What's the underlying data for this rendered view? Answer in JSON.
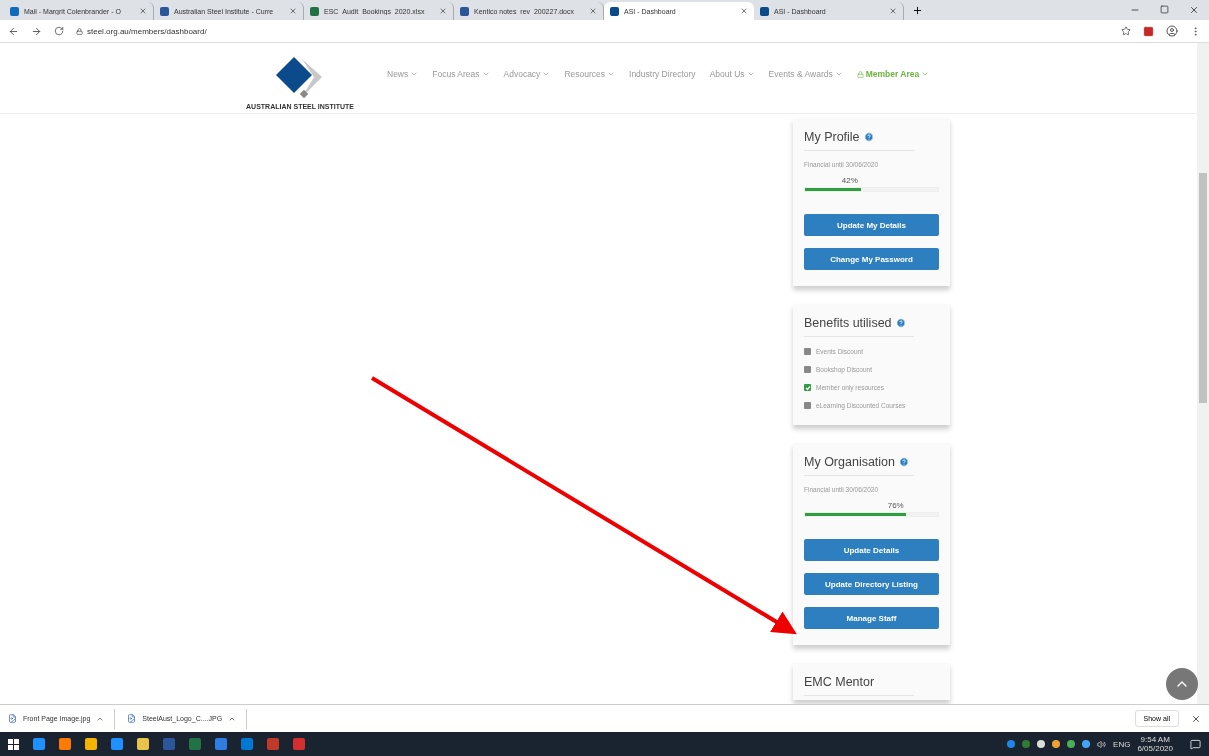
{
  "browser": {
    "tabs": [
      {
        "label": "Mail - Margrit Colenbrander - O",
        "selected": false,
        "color": "#0f6cbd"
      },
      {
        "label": "Australian Steel Institute - Curre",
        "selected": false,
        "color": "#2b579a"
      },
      {
        "label": "ESC_Audit_Bookings_2020.xlsx",
        "selected": false,
        "color": "#217346"
      },
      {
        "label": "Kentico notes_rev_200227.docx",
        "selected": false,
        "color": "#2b579a"
      },
      {
        "label": "ASI - Dashboard",
        "selected": true,
        "color": "#0b4a8b"
      },
      {
        "label": "ASI - Dashboard",
        "selected": false,
        "color": "#0b4a8b"
      }
    ],
    "url": "steel.org.au/members/dashboard/"
  },
  "site": {
    "logo_text": "AUSTRALIAN STEEL INSTITUTE",
    "nav": [
      {
        "label": "News",
        "dropdown": true,
        "kind": "plain"
      },
      {
        "label": "Focus Areas",
        "dropdown": true,
        "kind": "plain"
      },
      {
        "label": "Advocacy",
        "dropdown": true,
        "kind": "plain"
      },
      {
        "label": "Resources",
        "dropdown": true,
        "kind": "plain"
      },
      {
        "label": "Industry Directory",
        "dropdown": false,
        "kind": "plain"
      },
      {
        "label": "About Us",
        "dropdown": true,
        "kind": "plain"
      },
      {
        "label": "Events & Awards",
        "dropdown": true,
        "kind": "plain"
      },
      {
        "label": "Member Area",
        "dropdown": true,
        "kind": "member"
      }
    ]
  },
  "cards": [
    {
      "title": "My Profile",
      "kind": "progress",
      "subtitle": "Financial until 30/06/2020",
      "level": 0.42,
      "reading": "42%",
      "buttons": [
        "Update My Details",
        "Change My Password"
      ]
    },
    {
      "title": "Benefits utilised",
      "kind": "checklist",
      "items": [
        {
          "label": "Events Discount",
          "checked": false
        },
        {
          "label": "Bookshop Discount",
          "checked": false
        },
        {
          "label": "Member only resources",
          "checked": true
        },
        {
          "label": "eLearning Discounted Courses",
          "checked": false
        }
      ]
    },
    {
      "title": "My Organisation",
      "kind": "progress",
      "subtitle": "Financial until 30/06/2020",
      "level": 0.76,
      "reading": "76%",
      "buttons": [
        "Update Details",
        "Update Directory Listing",
        "Manage Staff"
      ]
    },
    {
      "title": "EMC Mentor",
      "kind": "partial"
    }
  ],
  "downloads": {
    "files": [
      "Front Page Image.jpg",
      "SteelAust_Logo_C....JPG"
    ],
    "show_all": "Show all"
  },
  "taskbar": {
    "apps": [
      {
        "color": "#1e90ff"
      },
      {
        "color": "#ff7a00"
      },
      {
        "color": "#f4b400"
      },
      {
        "color": "#1e90ff"
      },
      {
        "color": "#e8c34a"
      },
      {
        "color": "#2b579a"
      },
      {
        "color": "#217346"
      },
      {
        "color": "#2f7de1"
      },
      {
        "color": "#0078d4"
      },
      {
        "color": "#c0392b"
      },
      {
        "color": "#d32f2f"
      }
    ],
    "tray": [
      {
        "color": "#1e88e5"
      },
      {
        "color": "#2e7d32"
      },
      {
        "color": "#dddddd"
      },
      {
        "color": "#f0a030"
      },
      {
        "color": "#4caf50"
      },
      {
        "color": "#42a5f5"
      }
    ],
    "lang": "ENG",
    "time": "9:54 AM",
    "date": "6/05/2020"
  }
}
